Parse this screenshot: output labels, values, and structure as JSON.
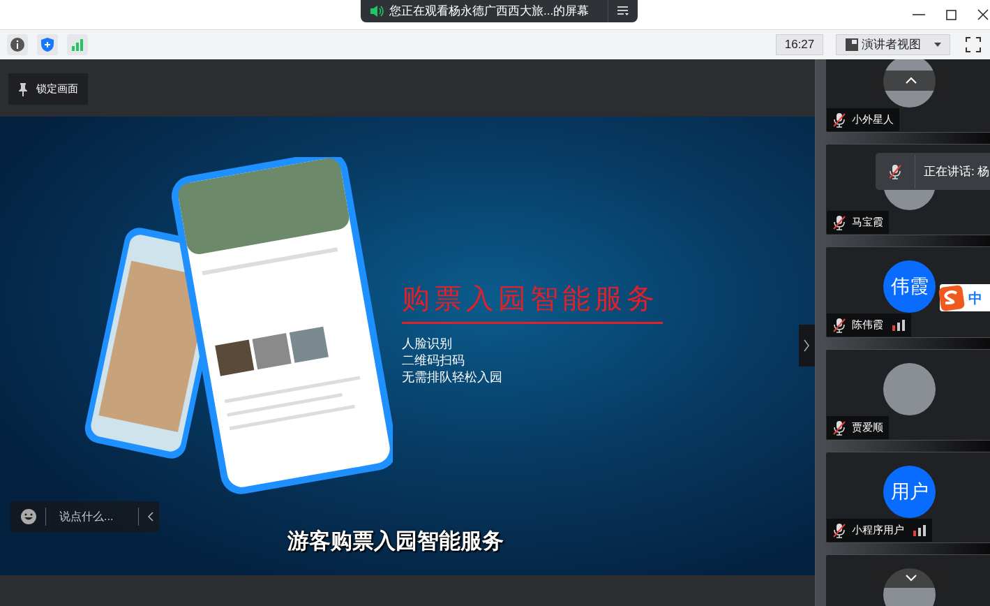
{
  "window": {
    "title": "您正在观看杨永德广西西大旅...的屏幕"
  },
  "toolbar": {
    "time": "16:27",
    "view_menu": "演讲者视图"
  },
  "lock_button": {
    "label": "锁定画面"
  },
  "slide": {
    "heading": "购票入园智能服务",
    "bullets": [
      "人脸识别",
      "二维码扫码",
      "无需排队轻松入园"
    ],
    "subtitle": "游客购票入园智能服务"
  },
  "chat": {
    "placeholder": "说点什么..."
  },
  "participants": [
    {
      "name": "小外星人",
      "avatar": {
        "kind": "photo"
      },
      "muted": true,
      "signal": false
    },
    {
      "name": "马宝霞",
      "avatar": {
        "kind": "photo"
      },
      "muted": true,
      "signal": false
    },
    {
      "name": "陈伟霞",
      "avatar": {
        "kind": "initials",
        "text": "伟霞"
      },
      "muted": true,
      "signal": true
    },
    {
      "name": "贾爱顺",
      "avatar": {
        "kind": "photo"
      },
      "muted": true,
      "signal": false
    },
    {
      "name": "小程序用户",
      "avatar": {
        "kind": "initials",
        "text": "用户"
      },
      "muted": true,
      "signal": true
    },
    {
      "avatar": {
        "kind": "photo"
      }
    }
  ],
  "speaking_toast": {
    "text": "正在讲话: 杨",
    "muted": true
  },
  "input_method": {
    "mode": "中"
  }
}
